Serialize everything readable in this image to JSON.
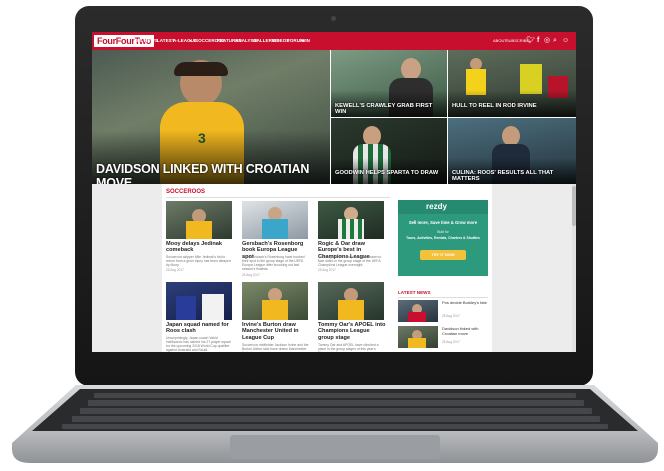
{
  "site": {
    "logo": "FourFourTwo"
  },
  "nav": {
    "items": [
      "EPL",
      "NEWS",
      "LATEST",
      "A-LEAGUE",
      "SOCCEROOS",
      "FEATURES",
      "ANALYSIS",
      "GALLERIES",
      "VIDEOS",
      "FORUM",
      "WIN"
    ],
    "right_links": [
      "ABOUT",
      "SUBSCRIBE"
    ]
  },
  "hero": {
    "main_headline": "DAVIDSON LINKED WITH CROATIAN MOVE",
    "tiles": [
      {
        "headline": "KEWELL'S CRAWLEY GRAB FIRST WIN"
      },
      {
        "headline": "HULL TO REEL IN ROD IRVINE"
      },
      {
        "headline": "GOODWIN HELPS SPARTA TO DRAW"
      },
      {
        "headline": "CULINA: ROOS' RESULTS ALL THAT MATTERS"
      }
    ]
  },
  "section": {
    "title": "SOCCEROOS"
  },
  "articles": [
    {
      "title": "Mooy delays Jedinak comeback",
      "excerpt": "Socceroos skipper Mile Jedinak's bid to return from a groin injury has been delayed by Mooy.",
      "date": "25 Aug 2017"
    },
    {
      "title": "Gersbach's Rosenborg book Europa League spot",
      "excerpt": "Alex Gersbach's Rosenborg have booked their spot in the group stage of the UEFA Europa League after knocking out last season's finalists.",
      "date": "25 Aug 2017"
    },
    {
      "title": "Rogic & Oar draw Europe's best in Champions League",
      "excerpt": "Tom Rogic and Tommy Oar were drawn to face sides in the group stage of the UEFA Champions League overnight.",
      "date": "25 Aug 2017"
    },
    {
      "title": "Japan squad named for Roos clash",
      "excerpt": "Unsurprisingly, Japan coach Vahid Halilhodzic has named his 27-player squad for the upcoming 2018 World Cup qualifier against Australia and Saudi.",
      "date": "25 Aug 2017"
    },
    {
      "title": "Irvine's Burton draw Manchester United in League Cup",
      "excerpt": "Socceroos midfielder Jackson Irvine and the Burton Albion side have drawn Manchester United.",
      "date": "25 Aug 2017"
    },
    {
      "title": "Tommy Oar's APOEL into Champions League group stage",
      "excerpt": "Tommy Oar and APOEL have clinched a place in the group stages of this year's Champions League.",
      "date": "25 Aug 2017"
    }
  ],
  "ad": {
    "brand": "rezdy",
    "tagline": "Sell more, Save time & Grow more",
    "subtitle": "Built for",
    "products": "Tours, Activities, Rentals, Charters & Shuttles",
    "cta": "TRY IT NOW"
  },
  "latest": {
    "title": "LATEST NEWS",
    "items": [
      {
        "text": "Pos decide Burkley's fate",
        "date": "25 Aug 2017"
      },
      {
        "text": "Davidson linked with Croatian move",
        "date": "25 Aug 2017"
      }
    ]
  },
  "colors": {
    "accent": "#c8102e",
    "ad_green": "#2d9a7e"
  }
}
